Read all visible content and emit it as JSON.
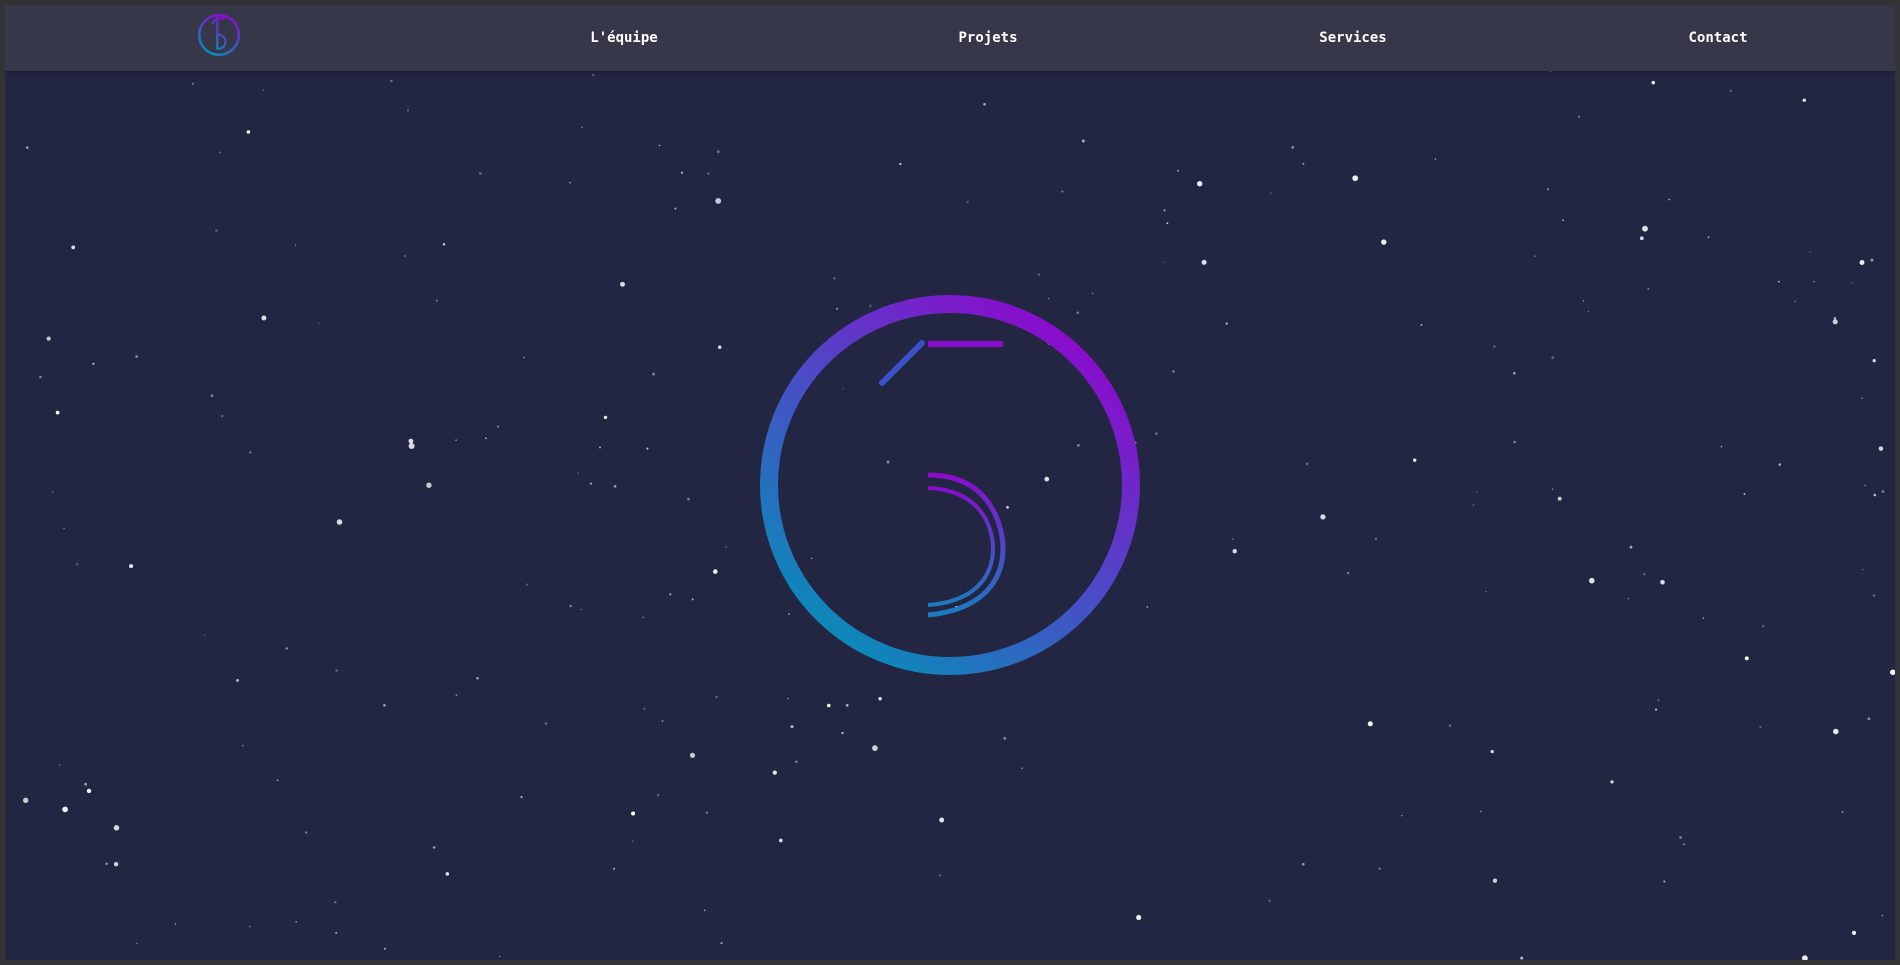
{
  "nav": {
    "logo_icon": "fifteen-logo-icon",
    "links": [
      {
        "label": "L'équipe"
      },
      {
        "label": "Projets"
      },
      {
        "label": "Services"
      },
      {
        "label": "Contact"
      }
    ]
  },
  "hero": {
    "logo_icon": "fifteen-logo-icon"
  },
  "colors": {
    "background": "#222642",
    "navbar": "#36384a",
    "nav_text": "#ffffff",
    "logo_gradient_start": "#8a0ccc",
    "logo_gradient_end": "#0b8ab8",
    "star": "#ffffff"
  }
}
